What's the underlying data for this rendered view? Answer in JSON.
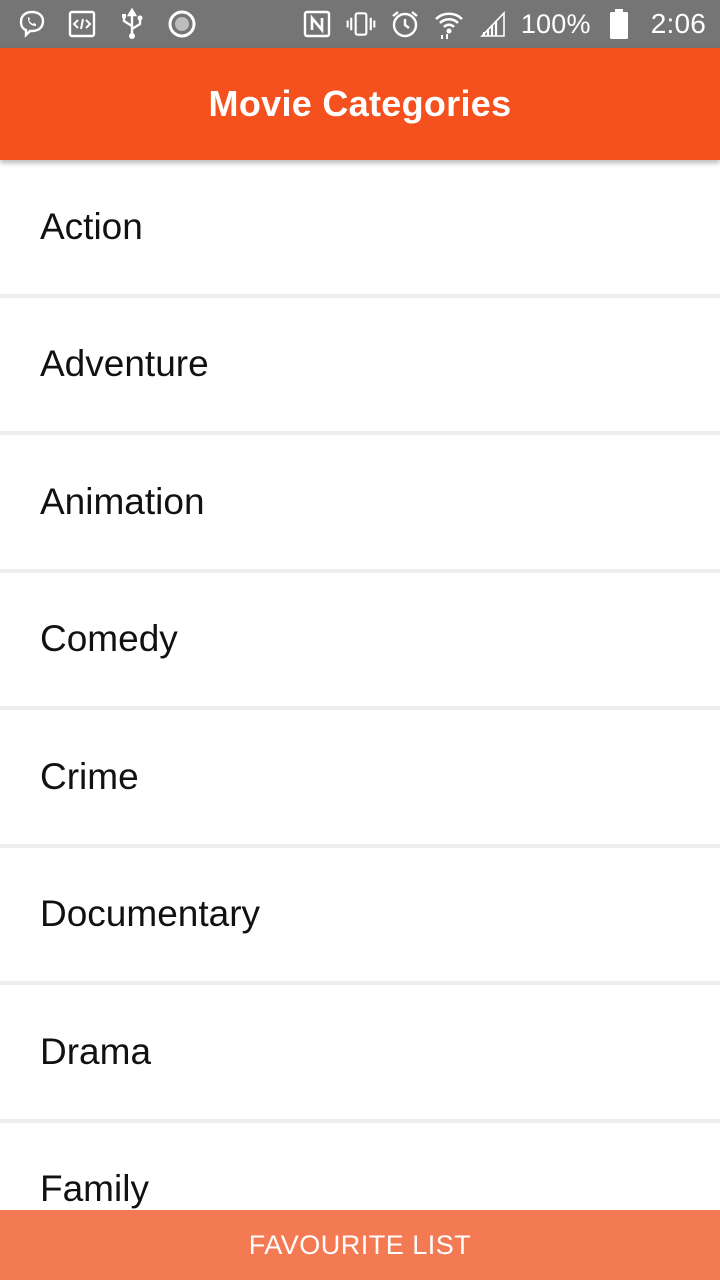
{
  "status_bar": {
    "left_icons": [
      "viber-icon",
      "developer-code-icon",
      "usb-icon",
      "record-icon"
    ],
    "right_icons": [
      "nfc-icon",
      "vibrate-icon",
      "alarm-icon",
      "wifi-icon",
      "cell-signal-icon",
      "battery-icon"
    ],
    "battery": "100%",
    "time": "2:06"
  },
  "app_bar": {
    "title": "Movie Categories",
    "color": "#f4511e"
  },
  "categories": [
    {
      "label": "Action"
    },
    {
      "label": "Adventure"
    },
    {
      "label": "Animation"
    },
    {
      "label": "Comedy"
    },
    {
      "label": "Crime"
    },
    {
      "label": "Documentary"
    },
    {
      "label": "Drama"
    },
    {
      "label": "Family"
    }
  ],
  "bottom_button": {
    "label": "FAVOURITE LIST",
    "color": "#f47a53"
  }
}
